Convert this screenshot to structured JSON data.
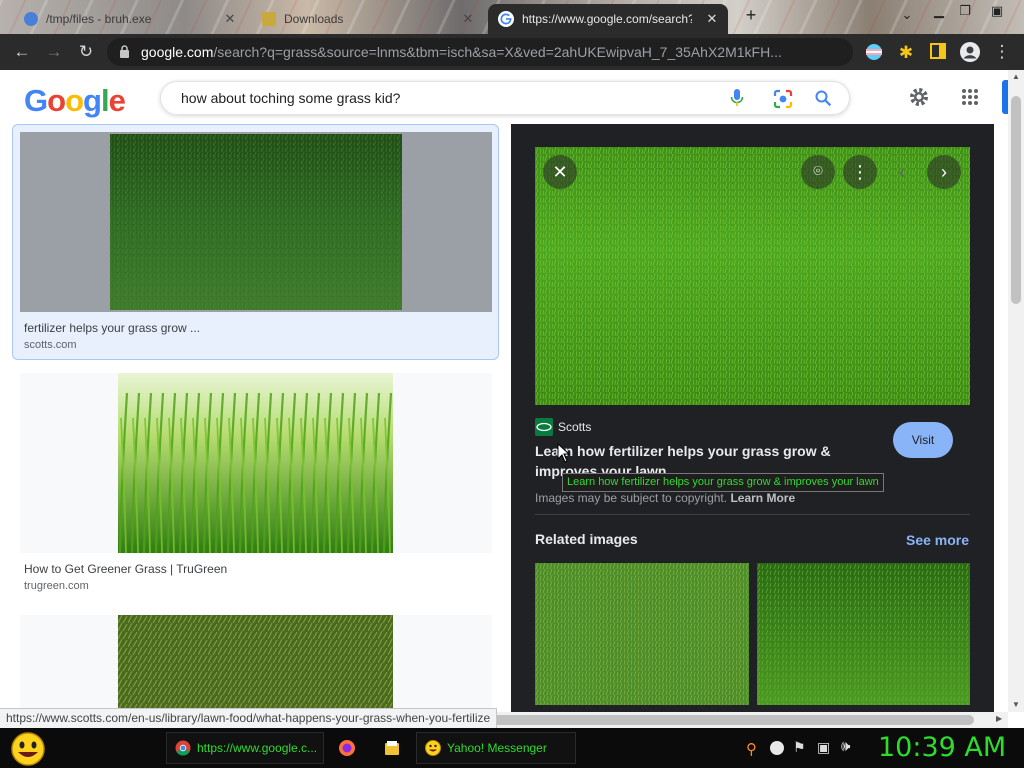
{
  "browser": {
    "tabs": [
      {
        "title": "/tmp/files - bruh.exe"
      },
      {
        "title": "Downloads"
      },
      {
        "title": "https://www.google.com/search?"
      }
    ],
    "address": {
      "host": "google.com",
      "path": "/search?q=grass&source=lnms&tbm=isch&sa=X&ved=2ahUKEwipvaH_7_35AhX2M1kFH..."
    },
    "status_url": "https://www.scotts.com/en-us/library/lawn-food/what-happens-your-grass-when-you-fertilize"
  },
  "google": {
    "logo": "Google",
    "query": "how about toching some grass kid?"
  },
  "results": [
    {
      "title": "fertilizer helps your grass grow ...",
      "source": "scotts.com"
    },
    {
      "title": "How to Get Greener Grass | TruGreen",
      "source": "trugreen.com"
    },
    {
      "title": "",
      "source": ""
    }
  ],
  "panel": {
    "site_name": "Scotts",
    "title_line1": "Learn how fertilizer helps your grass grow &",
    "title_line2": "improves your lawn",
    "tooltip": "Learn how fertilizer helps your grass grow & improves your lawn",
    "visit_label": "Visit",
    "copyright_text": "Images may be subject to copyright.",
    "learn_more": "Learn More",
    "related_heading": "Related images",
    "see_more": "See more"
  },
  "taskbar": {
    "items": [
      {
        "label": "https://www.google.c..."
      },
      {
        "label": "Yahoo! Messenger"
      }
    ],
    "clock": "10:39 AM"
  },
  "colors": {
    "chrome_dark": "#2b2b2b",
    "google_blue": "#4285f4",
    "google_red": "#ea4335",
    "google_yellow": "#fbbc05",
    "google_green": "#34a853",
    "selected_border": "#a8c7fa",
    "taskbar_green": "#2edc2e",
    "visit_button": "#8ab4f8"
  }
}
